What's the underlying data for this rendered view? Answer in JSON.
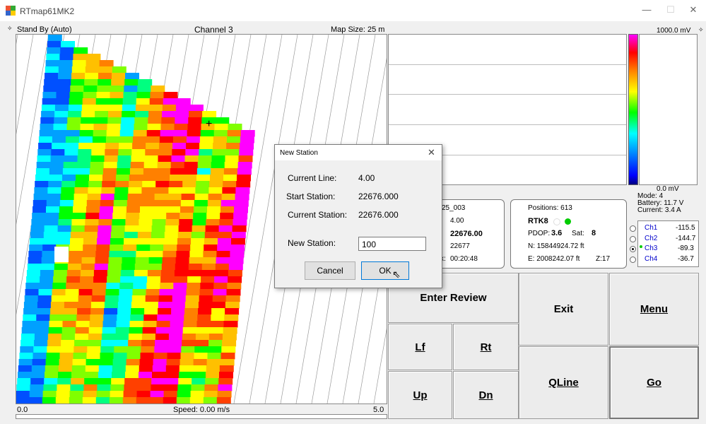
{
  "window": {
    "title": "RTmap61MK2",
    "minimize": "—",
    "maximize": "☐",
    "close": "✕"
  },
  "map_header": {
    "status": "Stand By (Auto)",
    "channel": "Channel 3",
    "map_size": "Map Size:  25 m"
  },
  "map_footer": {
    "left": "0.0",
    "speed": "Speed:  0.00 m/s",
    "right": "5.0"
  },
  "scale": {
    "top": "1000.0 mV",
    "bottom": "0.0 mV"
  },
  "line_info": {
    "file": "25_003",
    "line": "4.00",
    "station": "22676.00",
    "next": "22677",
    "time": "00:20:48",
    "line_prefix": ":",
    "time_prefix": "x:"
  },
  "gps": {
    "positions": "Positions: 613",
    "rtk": "RTK8",
    "pdop_label": "PDOP:",
    "pdop": "3.6",
    "sat_label": "Sat:",
    "sat": "8",
    "north": "N: 15844924.72 ft",
    "east": "E: 2008242.07 ft",
    "zone": "Z:17"
  },
  "instrument": {
    "mode": "Mode:   4",
    "battery": "Battery:  11.7 V",
    "current": "Current:  3.4 A"
  },
  "channels": [
    {
      "name": "Ch1",
      "value": "-115.5"
    },
    {
      "name": "Ch2",
      "value": "-144.7"
    },
    {
      "name": "Ch3",
      "value": "-89.3"
    },
    {
      "name": "Ch4",
      "value": "-36.7"
    }
  ],
  "buttons": {
    "enter_review": "Enter Review",
    "exit": "Exit",
    "menu": "Menu",
    "lf": "Lf",
    "rt": "Rt",
    "up": "Up",
    "dn": "Dn",
    "qline": "QLine",
    "go": "Go"
  },
  "dialog": {
    "title": "New Station",
    "current_line_label": "Current Line:",
    "current_line": "4.00",
    "start_station_label": "Start Station:",
    "start_station": "22676.000",
    "current_station_label": "Current Station:",
    "current_station": "22676.000",
    "new_station_label": "New Station:",
    "new_station": "100",
    "cancel": "Cancel",
    "ok": "OK"
  },
  "colors": {
    "selected_channel": "#0000cc",
    "gps_fix": "#00cc00"
  }
}
